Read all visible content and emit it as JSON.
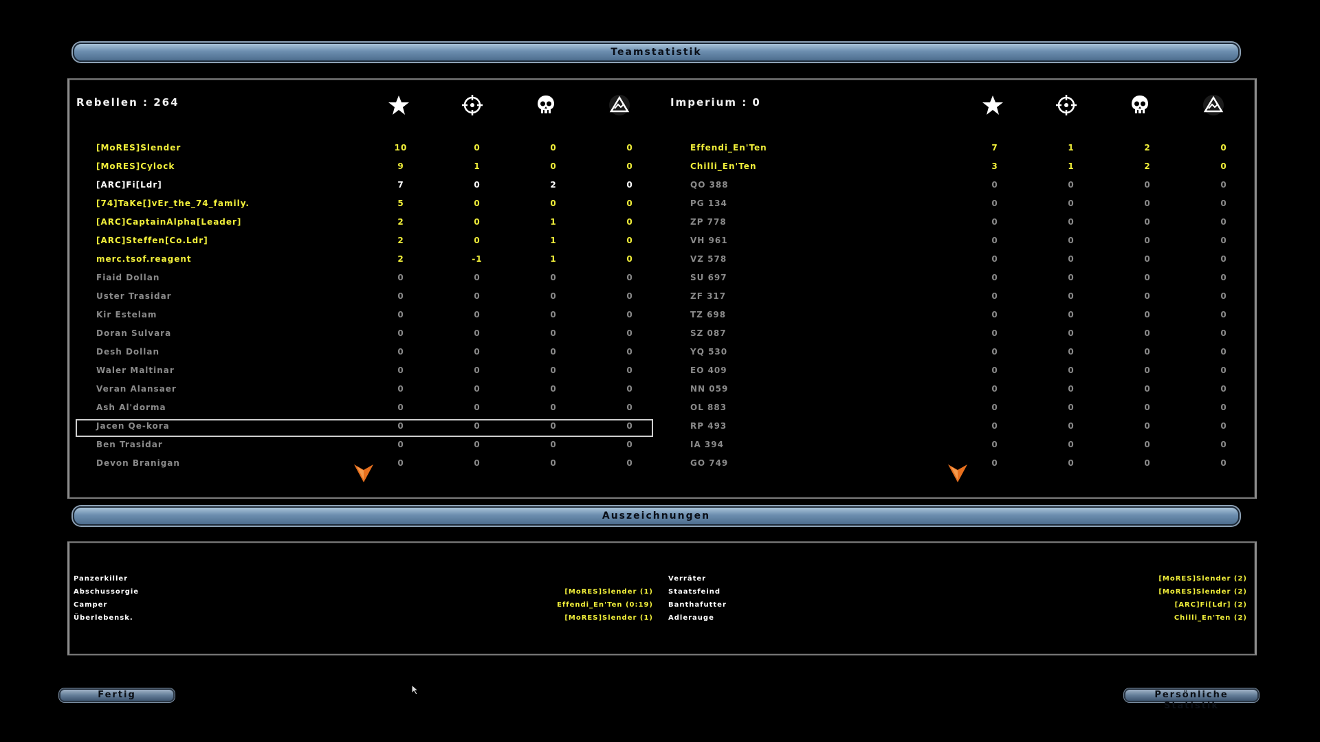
{
  "header": {
    "title": "Teamstatistik"
  },
  "awards_header": {
    "title": "Auszeichnungen"
  },
  "rebels": {
    "title": "Rebellen : 264",
    "players": [
      {
        "name": "[MoRES]Slender",
        "s": "10",
        "t": "0",
        "k": "0",
        "c": "0",
        "color": "yellow"
      },
      {
        "name": "[MoRES]Cylock",
        "s": "9",
        "t": "1",
        "k": "0",
        "c": "0",
        "color": "yellow"
      },
      {
        "name": "[ARC]Fi[Ldr]",
        "s": "7",
        "t": "0",
        "k": "2",
        "c": "0",
        "color": "white"
      },
      {
        "name": "[74]TaKe[]vEr_the_74_family.",
        "s": "5",
        "t": "0",
        "k": "0",
        "c": "0",
        "color": "yellow"
      },
      {
        "name": "[ARC]CaptainAlpha[Leader]",
        "s": "2",
        "t": "0",
        "k": "1",
        "c": "0",
        "color": "yellow"
      },
      {
        "name": "[ARC]Steffen[Co.Ldr]",
        "s": "2",
        "t": "0",
        "k": "1",
        "c": "0",
        "color": "yellow"
      },
      {
        "name": "merc.tsof.reagent",
        "s": "2",
        "t": "-1",
        "k": "1",
        "c": "0",
        "color": "yellow"
      },
      {
        "name": "Fiaid Dollan",
        "s": "0",
        "t": "0",
        "k": "0",
        "c": "0",
        "color": "gray"
      },
      {
        "name": "Uster Trasidar",
        "s": "0",
        "t": "0",
        "k": "0",
        "c": "0",
        "color": "gray"
      },
      {
        "name": "Kir Estelam",
        "s": "0",
        "t": "0",
        "k": "0",
        "c": "0",
        "color": "gray"
      },
      {
        "name": "Doran Sulvara",
        "s": "0",
        "t": "0",
        "k": "0",
        "c": "0",
        "color": "gray"
      },
      {
        "name": "Desh Dollan",
        "s": "0",
        "t": "0",
        "k": "0",
        "c": "0",
        "color": "gray"
      },
      {
        "name": "Waler Maltinar",
        "s": "0",
        "t": "0",
        "k": "0",
        "c": "0",
        "color": "gray"
      },
      {
        "name": "Veran Alansaer",
        "s": "0",
        "t": "0",
        "k": "0",
        "c": "0",
        "color": "gray"
      },
      {
        "name": "Ash Al'dorma",
        "s": "0",
        "t": "0",
        "k": "0",
        "c": "0",
        "color": "gray"
      },
      {
        "name": "Jacen Qe-kora",
        "s": "0",
        "t": "0",
        "k": "0",
        "c": "0",
        "color": "gray"
      },
      {
        "name": "Ben Trasidar",
        "s": "0",
        "t": "0",
        "k": "0",
        "c": "0",
        "color": "gray"
      },
      {
        "name": "Devon Branigan",
        "s": "0",
        "t": "0",
        "k": "0",
        "c": "0",
        "color": "gray"
      }
    ]
  },
  "empire": {
    "title": "Imperium : 0",
    "players": [
      {
        "name": "Effendi_En'Ten",
        "s": "7",
        "t": "1",
        "k": "2",
        "c": "0",
        "color": "yellow"
      },
      {
        "name": "Chilli_En'Ten",
        "s": "3",
        "t": "1",
        "k": "2",
        "c": "0",
        "color": "yellow"
      },
      {
        "name": "QO 388",
        "s": "0",
        "t": "0",
        "k": "0",
        "c": "0",
        "color": "gray"
      },
      {
        "name": "PG 134",
        "s": "0",
        "t": "0",
        "k": "0",
        "c": "0",
        "color": "gray"
      },
      {
        "name": "ZP 778",
        "s": "0",
        "t": "0",
        "k": "0",
        "c": "0",
        "color": "gray"
      },
      {
        "name": "VH 961",
        "s": "0",
        "t": "0",
        "k": "0",
        "c": "0",
        "color": "gray"
      },
      {
        "name": "VZ 578",
        "s": "0",
        "t": "0",
        "k": "0",
        "c": "0",
        "color": "gray"
      },
      {
        "name": "SU 697",
        "s": "0",
        "t": "0",
        "k": "0",
        "c": "0",
        "color": "gray"
      },
      {
        "name": "ZF 317",
        "s": "0",
        "t": "0",
        "k": "0",
        "c": "0",
        "color": "gray"
      },
      {
        "name": "TZ 698",
        "s": "0",
        "t": "0",
        "k": "0",
        "c": "0",
        "color": "gray"
      },
      {
        "name": "SZ 087",
        "s": "0",
        "t": "0",
        "k": "0",
        "c": "0",
        "color": "gray"
      },
      {
        "name": "YQ 530",
        "s": "0",
        "t": "0",
        "k": "0",
        "c": "0",
        "color": "gray"
      },
      {
        "name": "EO 409",
        "s": "0",
        "t": "0",
        "k": "0",
        "c": "0",
        "color": "gray"
      },
      {
        "name": "NN 059",
        "s": "0",
        "t": "0",
        "k": "0",
        "c": "0",
        "color": "gray"
      },
      {
        "name": "OL 883",
        "s": "0",
        "t": "0",
        "k": "0",
        "c": "0",
        "color": "gray"
      },
      {
        "name": "RP 493",
        "s": "0",
        "t": "0",
        "k": "0",
        "c": "0",
        "color": "gray"
      },
      {
        "name": "IA 394",
        "s": "0",
        "t": "0",
        "k": "0",
        "c": "0",
        "color": "gray"
      },
      {
        "name": "GO 749",
        "s": "0",
        "t": "0",
        "k": "0",
        "c": "0",
        "color": "gray"
      }
    ]
  },
  "selected_row": 15,
  "column_icons": [
    "star-icon",
    "crosshair-icon",
    "skull-icon",
    "vehicle-destroyed-icon"
  ],
  "awards": {
    "left": [
      {
        "label": "Panzerkiller",
        "value": ""
      },
      {
        "label": "Abschussorgie",
        "value": "[MoRES]Slender (1)"
      },
      {
        "label": "Camper",
        "value": "Effendi_En'Ten (0:19)"
      },
      {
        "label": "Überlebensk.",
        "value": "[MoRES]Slender (1)"
      }
    ],
    "right": [
      {
        "label": "Verräter",
        "value": "[MoRES]Slender (2)"
      },
      {
        "label": "Staatsfeind",
        "value": "[MoRES]Slender (2)"
      },
      {
        "label": "Banthafutter",
        "value": "[ARC]Fi[Ldr] (2)"
      },
      {
        "label": "Adlerauge",
        "value": "Chilli_En'Ten (2)"
      }
    ]
  },
  "buttons": {
    "done": "Fertig",
    "personal": "Persönliche Statistik"
  },
  "colors": {
    "yellow": "#f1ef3a",
    "white": "#ffffff",
    "gray": "#8a8a8a",
    "accent_arrow": "#e8701e"
  }
}
